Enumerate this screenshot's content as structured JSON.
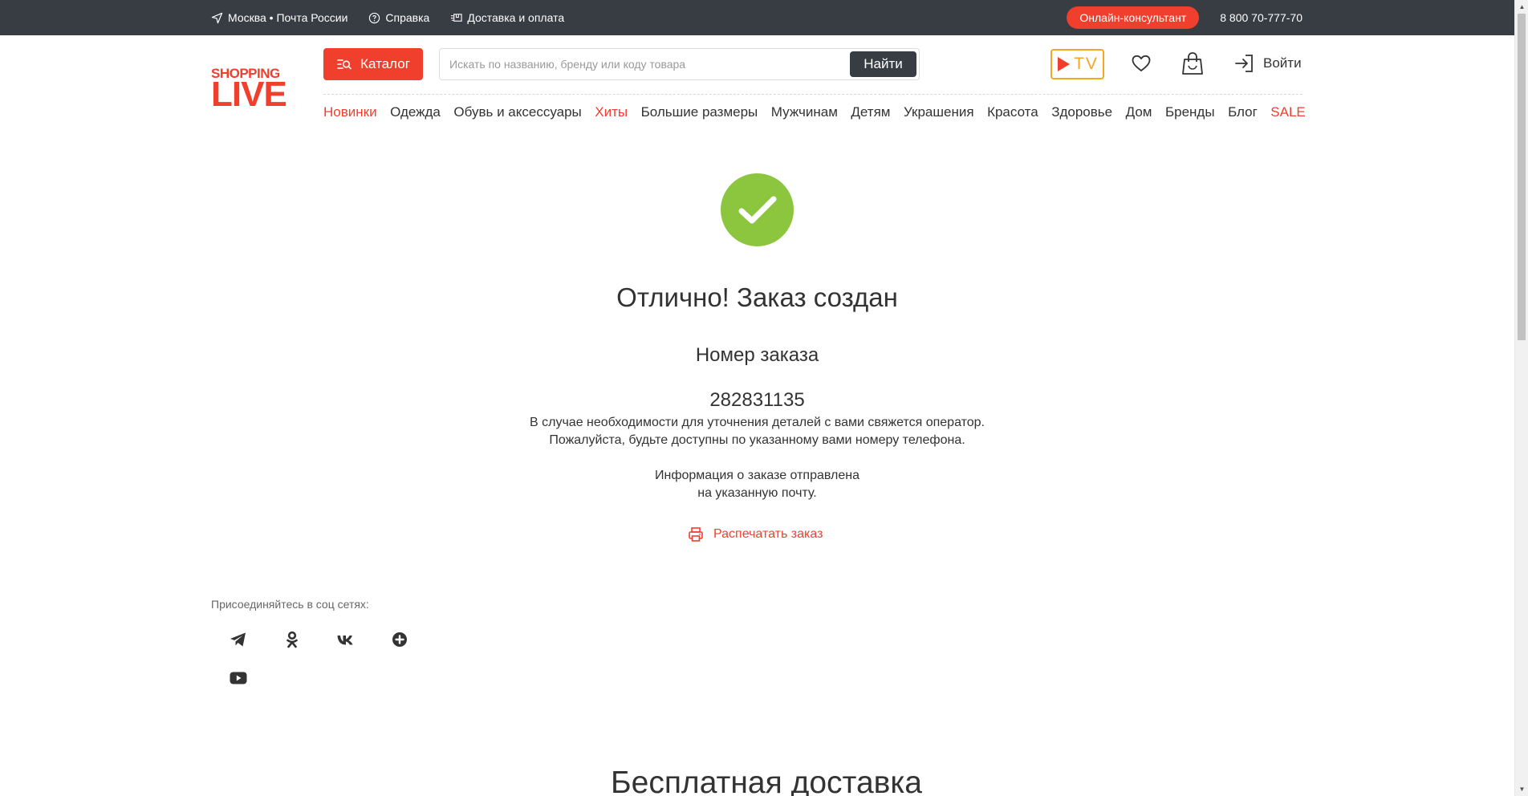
{
  "topbar": {
    "location": "Москва • Почта России",
    "help": "Справка",
    "delivery": "Доставка и оплата",
    "consultant": "Онлайн-консультант",
    "phone": "8 800 70-777-70",
    "bg_color": "#383c43"
  },
  "header": {
    "logo_top": "SHOPPING",
    "logo_bottom": "LIVE",
    "catalog_label": "Каталог",
    "search_placeholder": "Искать по названию, бренду или коду товара",
    "search_button": "Найти",
    "tv_label": "TV",
    "login_label": "Войти",
    "accent_color": "#f13f2d"
  },
  "nav": {
    "items": [
      {
        "label": "Новинки",
        "highlight": true
      },
      {
        "label": "Одежда",
        "highlight": false
      },
      {
        "label": "Обувь и аксессуары",
        "highlight": false
      },
      {
        "label": "Хиты",
        "highlight": true
      },
      {
        "label": "Большие размеры",
        "highlight": false
      },
      {
        "label": "Мужчинам",
        "highlight": false
      },
      {
        "label": "Детям",
        "highlight": false
      },
      {
        "label": "Украшения",
        "highlight": false
      },
      {
        "label": "Красота",
        "highlight": false
      },
      {
        "label": "Здоровье",
        "highlight": false
      },
      {
        "label": "Дом",
        "highlight": false
      },
      {
        "label": "Бренды",
        "highlight": false
      },
      {
        "label": "Блог",
        "highlight": false
      },
      {
        "label": "SALE",
        "highlight": true
      }
    ]
  },
  "order": {
    "title": "Отлично! Заказ создан",
    "number_label": "Номер заказа",
    "number": "282831135",
    "info_line1": "В случае необходимости для уточнения деталей с вами свяжется оператор.",
    "info_line2": "Пожалуйста, будьте доступны по указанному вами номеру телефона.",
    "email_line1": "Информация о заказе отправлена",
    "email_line2": "на указанную почту.",
    "print_label": "Распечатать заказ",
    "success_color": "#8cc63f"
  },
  "social": {
    "title": "Присоединяйтесь в соц сетях:",
    "networks": [
      "telegram-icon",
      "odnoklassniki-icon",
      "vk-icon",
      "plus-icon",
      "youtube-icon"
    ]
  },
  "promo": {
    "heading": "Бесплатная доставка"
  }
}
